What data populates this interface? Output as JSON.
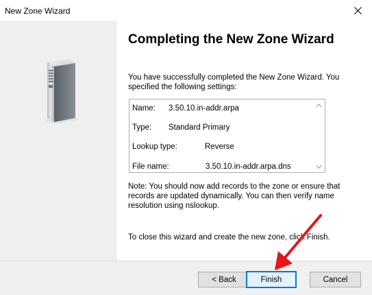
{
  "window": {
    "title": "New Zone Wizard"
  },
  "icons": {
    "close": "close-icon",
    "server": "server-icon",
    "scroll_up": "chevron-up-icon",
    "scroll_down": "chevron-down-icon"
  },
  "content": {
    "heading": "Completing the New Zone Wizard",
    "intro": "You have successfully completed the New Zone Wizard. You specified the following settings:",
    "settings": [
      {
        "label": "Name:",
        "value": "3.50.10.in-addr.arpa"
      },
      {
        "label": "Type:",
        "value": "Standard Primary"
      },
      {
        "label": "Lookup type:",
        "value": "Reverse"
      },
      {
        "label": "File name:",
        "value": "3.50.10.in-addr.arpa.dns"
      }
    ],
    "note": "Note: You should now add records to the zone or ensure that records are updated dynamically. You can then verify name resolution using nslookup.",
    "close_instruction": "To close this wizard and create the new zone, click Finish."
  },
  "buttons": {
    "back": "< Back",
    "finish": "Finish",
    "cancel": "Cancel"
  },
  "colors": {
    "left_panel": "#efefef",
    "footer": "#f0f0f0",
    "focus_border": "#0078d7",
    "annotation_arrow": "#e8141c"
  }
}
